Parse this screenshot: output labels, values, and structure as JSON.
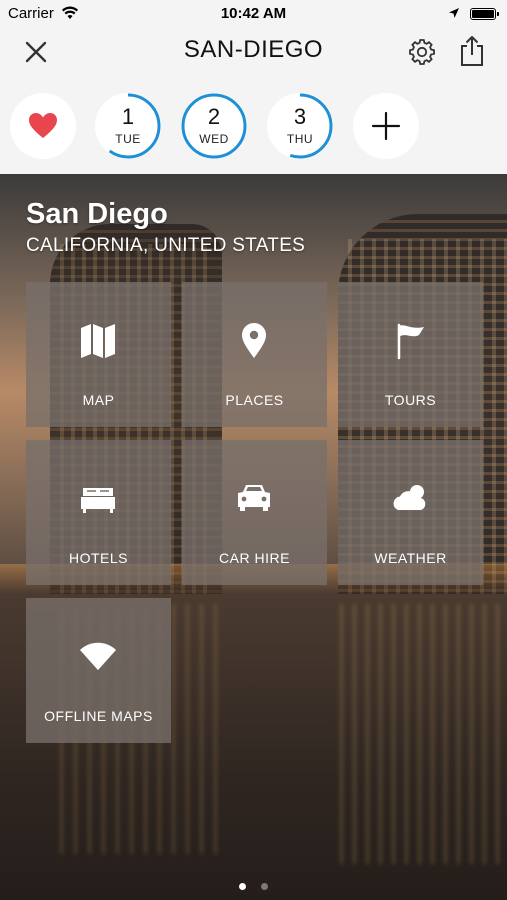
{
  "status_bar": {
    "carrier": "Carrier",
    "time": "10:42 AM"
  },
  "nav": {
    "title": "SAN-DIEGO",
    "close_icon": "close-icon",
    "settings_icon": "gear-icon",
    "share_icon": "share-icon"
  },
  "days": {
    "favorite_icon": "heart-icon",
    "favorite_color": "#e8454f",
    "ring_color": "#1f8fd6",
    "items": [
      {
        "number": "1",
        "weekday": "TUE",
        "progress": 0.6
      },
      {
        "number": "2",
        "weekday": "WED",
        "progress": 1.0
      },
      {
        "number": "3",
        "weekday": "THU",
        "progress": 0.55
      }
    ],
    "add_icon": "plus-icon"
  },
  "hero": {
    "city": "San Diego",
    "subtitle": "CALIFORNIA, UNITED STATES"
  },
  "tiles": [
    {
      "label": "MAP",
      "icon": "map-icon"
    },
    {
      "label": "PLACES",
      "icon": "location-pin-icon"
    },
    {
      "label": "TOURS",
      "icon": "flag-icon"
    },
    {
      "label": "HOTELS",
      "icon": "bed-icon"
    },
    {
      "label": "CAR HIRE",
      "icon": "car-icon"
    },
    {
      "label": "WEATHER",
      "icon": "cloud-sun-icon"
    },
    {
      "label": "OFFLINE MAPS",
      "icon": "wifi-icon"
    }
  ],
  "pagination": {
    "current_page": 1,
    "total_pages": 2
  }
}
